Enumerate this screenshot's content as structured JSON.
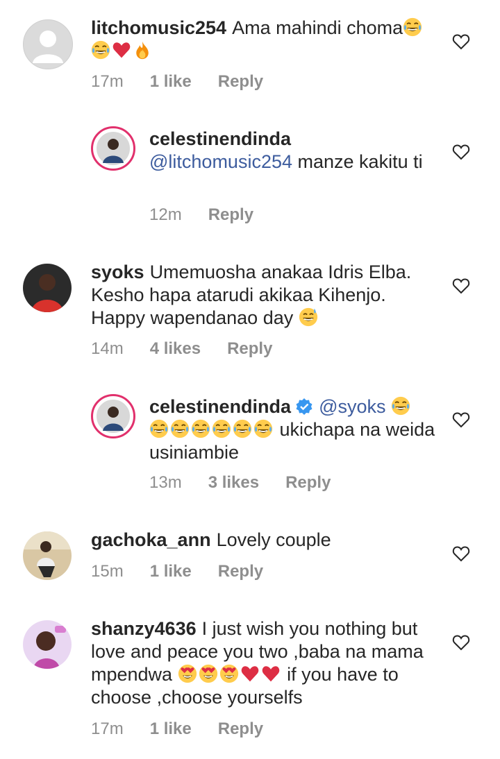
{
  "comments": [
    {
      "username": "litchomusic254",
      "text": "Ama mahindi choma",
      "emojis_inline": [
        "laughing-tears"
      ],
      "emojis_line2": [
        "laughing-tears",
        "red-heart",
        "fire"
      ],
      "time": "17m",
      "likes": "1 like",
      "reply_label": "Reply"
    },
    {
      "username": "celestinendinda",
      "mention": "@litchomusic254",
      "text": "manze kakitu ti",
      "time": "12m",
      "reply_label": "Reply"
    },
    {
      "username": "syoks",
      "text": "Umemuosha anakaa Idris Elba. Kesho hapa atarudi akikaa Kihenjo. Happy wapendanao day",
      "emojis": [
        "grinning-sweat"
      ],
      "time": "14m",
      "likes": "4 likes",
      "reply_label": "Reply"
    },
    {
      "username": "celestinendinda",
      "verified": true,
      "mention": "@syoks",
      "text": "ukichapa na weida usiniambie",
      "emojis": [
        "laughing-tears",
        "laughing-tears",
        "laughing-tears",
        "laughing-tears",
        "laughing-tears",
        "laughing-tears",
        "laughing-tears"
      ],
      "time": "13m",
      "likes": "3 likes",
      "reply_label": "Reply"
    },
    {
      "username": "gachoka_ann",
      "text": "Lovely couple",
      "time": "15m",
      "likes": "1 like",
      "reply_label": "Reply"
    },
    {
      "username": "shanzy4636",
      "text_a": "I just wish you nothing but love and peace you two ,baba na mama mpendwa",
      "emojis": [
        "heart-eyes",
        "heart-eyes",
        "heart-eyes",
        "red-heart",
        "red-heart"
      ],
      "text_b": "if you have to choose ,choose yourselfs",
      "time": "17m",
      "likes": "1 like",
      "reply_label": "Reply"
    }
  ],
  "icons": {
    "like": "heart-outline-icon"
  },
  "colors": {
    "text": "#262626",
    "meta": "#8e8e8e",
    "mention": "#3d5c9e",
    "verified": "#3897f0",
    "story_ring": "#e1306c"
  }
}
